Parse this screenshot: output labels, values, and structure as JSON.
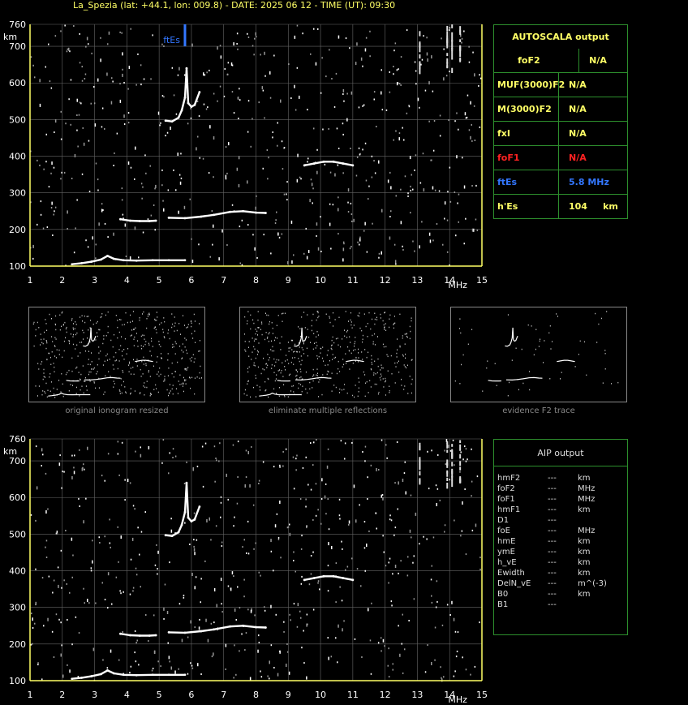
{
  "header": "La_Spezia (lat: +44.1, lon: 009.8) - DATE: 2025 06 12 - TIME (UT): 09:30",
  "colors": {
    "axis": "#ffff66",
    "grid": "#666666",
    "trace": "#ffffff",
    "es": "#3377ff",
    "red": "#ff2222",
    "green": "#2d8f2d"
  },
  "chart_data": [
    {
      "type": "scatter",
      "name": "main-ionogram",
      "xlabel": "MHz",
      "ylabel": "km",
      "xlim": [
        1,
        15
      ],
      "ylim": [
        100,
        760
      ],
      "x_ticks": [
        "1",
        "2",
        "3",
        "4",
        "5",
        "6",
        "7",
        "8",
        "9",
        "10",
        "11",
        "12",
        "13",
        "14",
        "15"
      ],
      "y_ticks": [
        "100",
        "200",
        "300",
        "400",
        "500",
        "600",
        "700",
        "760"
      ],
      "grid": true,
      "annotation": {
        "label": "ftEs",
        "x": 5.8
      },
      "traces": [
        {
          "x": [
            2.3,
            2.6,
            2.9,
            3.2,
            3.4,
            3.6,
            3.9,
            4.3,
            4.8,
            5.3,
            5.8
          ],
          "y": [
            105,
            108,
            112,
            118,
            128,
            120,
            116,
            115,
            116,
            116,
            116
          ]
        },
        {
          "x": [
            3.8,
            4.1,
            4.4,
            4.7,
            4.9
          ],
          "y": [
            228,
            224,
            223,
            223,
            224
          ]
        },
        {
          "x": [
            5.2,
            5.4,
            5.6,
            5.7,
            5.8,
            5.85,
            5.9,
            6.0,
            6.1,
            6.25
          ],
          "y": [
            497,
            495,
            505,
            525,
            560,
            640,
            545,
            535,
            540,
            575
          ]
        },
        {
          "x": [
            5.3,
            5.8,
            6.3,
            6.7,
            7.2,
            7.6,
            8.0,
            8.3
          ],
          "y": [
            232,
            231,
            235,
            240,
            248,
            250,
            246,
            245
          ]
        },
        {
          "x": [
            9.5,
            9.8,
            10.1,
            10.4,
            10.7,
            11.0
          ],
          "y": [
            375,
            380,
            385,
            385,
            380,
            375
          ]
        }
      ]
    },
    {
      "type": "scatter",
      "name": "aip-ionogram",
      "xlabel": "MHz",
      "ylabel": "km",
      "xlim": [
        1,
        15
      ],
      "ylim": [
        100,
        760
      ],
      "x_ticks": [
        "1",
        "2",
        "3",
        "4",
        "5",
        "6",
        "7",
        "8",
        "9",
        "10",
        "11",
        "12",
        "13",
        "14",
        "15"
      ],
      "y_ticks": [
        "100",
        "200",
        "300",
        "400",
        "500",
        "600",
        "700",
        "760"
      ],
      "grid": true
    }
  ],
  "thumbnails": [
    "original ionogram resized",
    "eliminate multiple reflections",
    "evidence F2 trace"
  ],
  "autoscala": {
    "title": "AUTOSCALA output",
    "rows": [
      {
        "k": "foF2",
        "v": "N/A",
        "color": "#ffff66"
      },
      {
        "k": "MUF(3000)F2",
        "v": "N/A",
        "color": "#ffff66"
      },
      {
        "k": "M(3000)F2",
        "v": "N/A",
        "color": "#ffff66"
      },
      {
        "k": "fxI",
        "v": "N/A",
        "color": "#ffff66"
      },
      {
        "k": "foF1",
        "v": "N/A",
        "color": "#ff2222"
      },
      {
        "k": "ftEs",
        "v": "5.8 MHz",
        "color": "#3377ff"
      },
      {
        "k": "h'Es",
        "v": "104     km",
        "color": "#ffff66"
      }
    ]
  },
  "aip": {
    "title": "AIP output",
    "rows": [
      [
        "hmF2",
        "---",
        "km"
      ],
      [
        "foF2",
        "---",
        "MHz"
      ],
      [
        "foF1",
        "---",
        "MHz"
      ],
      [
        "hmF1",
        "---",
        "km"
      ],
      [
        "D1",
        "---",
        ""
      ],
      [
        "foE",
        "---",
        "MHz"
      ],
      [
        "hmE",
        "---",
        "km"
      ],
      [
        "ymE",
        "---",
        "km"
      ],
      [
        "h_vE",
        "---",
        "km"
      ],
      [
        "Ewidth",
        "---",
        "km"
      ],
      [
        "DelN_vE",
        "---",
        "m^(-3)"
      ],
      [
        "B0",
        "---",
        "km"
      ],
      [
        "B1",
        "---",
        ""
      ]
    ]
  }
}
